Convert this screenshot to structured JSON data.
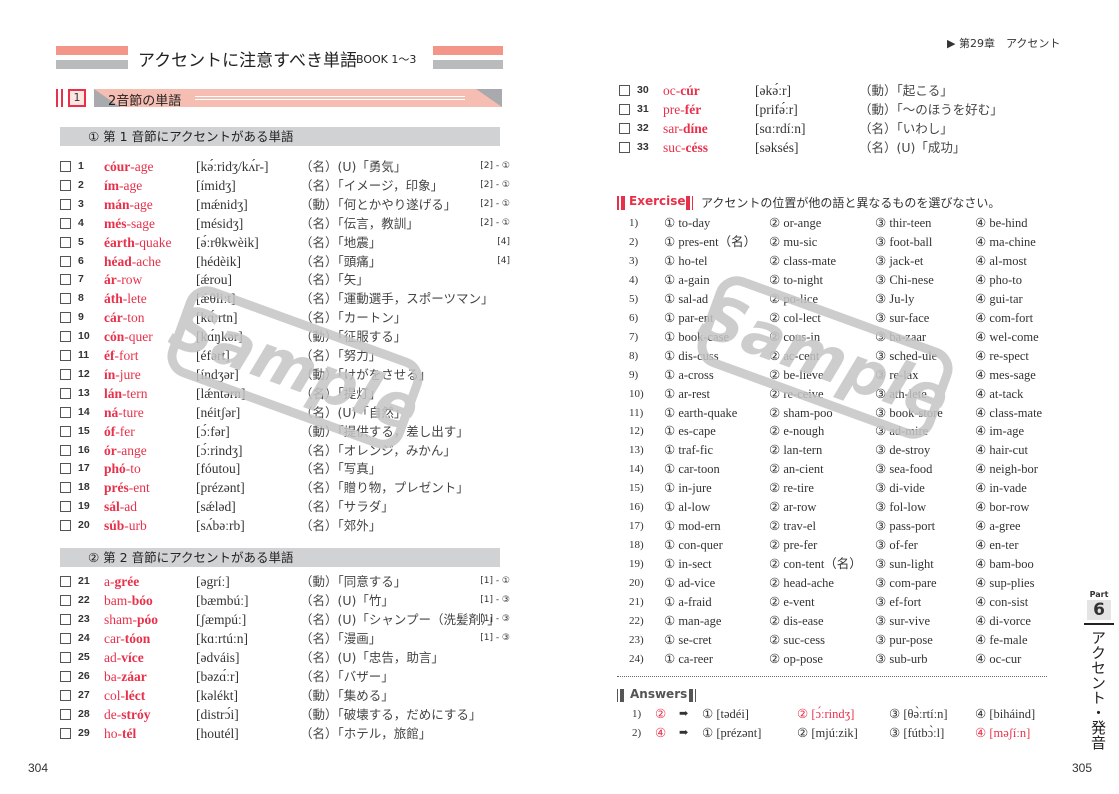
{
  "left_page": {
    "title": "アクセントに注意すべき単語",
    "title_sub": "BOOK 1〜3",
    "section_num": "1",
    "section_title": "2音節の単語",
    "sub1": "① 第 1 音節にアクセントがある単語",
    "sub2": "② 第 2 音節にアクセントがある単語",
    "page_number": "304",
    "entries1": [
      {
        "n": "1",
        "w": [
          {
            "t": "cóur",
            "b": true
          },
          {
            "t": "-age",
            "b": false
          }
        ],
        "p": "[kə́ːridʒ/kʌ́r-]",
        "m": "（名）(U)「勇気」",
        "r": "[2] - ①"
      },
      {
        "n": "2",
        "w": [
          {
            "t": "ím",
            "b": true
          },
          {
            "t": "-age",
            "b": false
          }
        ],
        "p": "[ímidʒ]",
        "m": "（名）「イメージ，印象」",
        "r": "[2] - ①"
      },
      {
        "n": "3",
        "w": [
          {
            "t": "mán",
            "b": true
          },
          {
            "t": "-age",
            "b": false
          }
        ],
        "p": "[mǽnidʒ]",
        "m": "（動）「何とかやり遂げる」",
        "r": "[2] - ①"
      },
      {
        "n": "4",
        "w": [
          {
            "t": "més",
            "b": true
          },
          {
            "t": "-sage",
            "b": false
          }
        ],
        "p": "[mésidʒ]",
        "m": "（名）「伝言，教訓」",
        "r": "[2] - ①"
      },
      {
        "n": "5",
        "w": [
          {
            "t": "éarth",
            "b": true
          },
          {
            "t": "-quake",
            "b": false
          }
        ],
        "p": "[ə́ːrθkwèik]",
        "m": "（名）「地震」",
        "r": "[4]"
      },
      {
        "n": "6",
        "w": [
          {
            "t": "héad",
            "b": true
          },
          {
            "t": "-ache",
            "b": false
          }
        ],
        "p": "[hédèik]",
        "m": "（名）「頭痛」",
        "r": "[4]"
      },
      {
        "n": "7",
        "w": [
          {
            "t": "ár",
            "b": true
          },
          {
            "t": "-row",
            "b": false
          }
        ],
        "p": "[ǽrou]",
        "m": "（名）「矢」",
        "r": ""
      },
      {
        "n": "8",
        "w": [
          {
            "t": "áth",
            "b": true
          },
          {
            "t": "-lete",
            "b": false
          }
        ],
        "p": "[ǽθliːt]",
        "m": "（名）「運動選手，スポーツマン」",
        "r": ""
      },
      {
        "n": "9",
        "w": [
          {
            "t": "cár",
            "b": true
          },
          {
            "t": "-ton",
            "b": false
          }
        ],
        "p": "[kɑ́ːrtn]",
        "m": "（名）「カートン」",
        "r": ""
      },
      {
        "n": "10",
        "w": [
          {
            "t": "cón",
            "b": true
          },
          {
            "t": "-quer",
            "b": false
          }
        ],
        "p": "[kɑ́ŋkər]",
        "m": "（動）「征服する」",
        "r": ""
      },
      {
        "n": "11",
        "w": [
          {
            "t": "éf",
            "b": true
          },
          {
            "t": "-fort",
            "b": false
          }
        ],
        "p": "[éfərt]",
        "m": "（名）「努力」",
        "r": ""
      },
      {
        "n": "12",
        "w": [
          {
            "t": "ín",
            "b": true
          },
          {
            "t": "-jure",
            "b": false
          }
        ],
        "p": "[índʒər]",
        "m": "（動）「けがをさせる」",
        "r": ""
      },
      {
        "n": "13",
        "w": [
          {
            "t": "lán",
            "b": true
          },
          {
            "t": "-tern",
            "b": false
          }
        ],
        "p": "[lǽntərn]",
        "m": "（名）「提灯」",
        "r": ""
      },
      {
        "n": "14",
        "w": [
          {
            "t": "ná",
            "b": true
          },
          {
            "t": "-ture",
            "b": false
          }
        ],
        "p": "[néitʃər]",
        "m": "（名）(U)「自然」",
        "r": ""
      },
      {
        "n": "15",
        "w": [
          {
            "t": "óf",
            "b": true
          },
          {
            "t": "-fer",
            "b": false
          }
        ],
        "p": "[ɔ́ːfər]",
        "m": "（動）「提供する，差し出す」",
        "r": ""
      },
      {
        "n": "16",
        "w": [
          {
            "t": "ór",
            "b": true
          },
          {
            "t": "-ange",
            "b": false
          }
        ],
        "p": "[ɔ́ːrindʒ]",
        "m": "（名）「オレンジ，みかん」",
        "r": ""
      },
      {
        "n": "17",
        "w": [
          {
            "t": "phó",
            "b": true
          },
          {
            "t": "-to",
            "b": false
          }
        ],
        "p": "[fóutou]",
        "m": "（名）「写真」",
        "r": ""
      },
      {
        "n": "18",
        "w": [
          {
            "t": "prés",
            "b": true
          },
          {
            "t": "-ent",
            "b": false
          }
        ],
        "p": "[prézənt]",
        "m": "（名）「贈り物，プレゼント」",
        "r": ""
      },
      {
        "n": "19",
        "w": [
          {
            "t": "sál",
            "b": true
          },
          {
            "t": "-ad",
            "b": false
          }
        ],
        "p": "[sǽləd]",
        "m": "（名）「サラダ」",
        "r": ""
      },
      {
        "n": "20",
        "w": [
          {
            "t": "súb",
            "b": true
          },
          {
            "t": "-urb",
            "b": false
          }
        ],
        "p": "[sʌ́bəːrb]",
        "m": "（名）「郊外」",
        "r": ""
      }
    ],
    "entries2": [
      {
        "n": "21",
        "w": [
          {
            "t": "a-",
            "b": false
          },
          {
            "t": "grée",
            "b": true
          }
        ],
        "p": "[əgríː]",
        "m": "（動）「同意する」",
        "r": "[1] - ①"
      },
      {
        "n": "22",
        "w": [
          {
            "t": "bam-",
            "b": false
          },
          {
            "t": "bóo",
            "b": true
          }
        ],
        "p": "[bæmbúː]",
        "m": "（名）(U)「竹」",
        "r": "[1] - ③"
      },
      {
        "n": "23",
        "w": [
          {
            "t": "sham-",
            "b": false
          },
          {
            "t": "póo",
            "b": true
          }
        ],
        "p": "[ʃæmpúː]",
        "m": "（名）(U)「シャンプー（洗髪剤）」",
        "r": "[1] - ③"
      },
      {
        "n": "24",
        "w": [
          {
            "t": "car-",
            "b": false
          },
          {
            "t": "tóon",
            "b": true
          }
        ],
        "p": "[kɑːrtúːn]",
        "m": "（名）「漫画」",
        "r": "[1] - ③"
      },
      {
        "n": "25",
        "w": [
          {
            "t": "ad-",
            "b": false
          },
          {
            "t": "více",
            "b": true
          }
        ],
        "p": "[ədváis]",
        "m": "（名）(U)「忠告，助言」",
        "r": ""
      },
      {
        "n": "26",
        "w": [
          {
            "t": "ba-",
            "b": false
          },
          {
            "t": "záar",
            "b": true
          }
        ],
        "p": "[bəzɑ́ːr]",
        "m": "（名）「バザー」",
        "r": ""
      },
      {
        "n": "27",
        "w": [
          {
            "t": "col-",
            "b": false
          },
          {
            "t": "léct",
            "b": true
          }
        ],
        "p": "[kəlékt]",
        "m": "（動）「集める」",
        "r": ""
      },
      {
        "n": "28",
        "w": [
          {
            "t": "de-",
            "b": false
          },
          {
            "t": "stróy",
            "b": true
          }
        ],
        "p": "[distrɔ́i]",
        "m": "（動）「破壊する，だめにする」",
        "r": ""
      },
      {
        "n": "29",
        "w": [
          {
            "t": "ho-",
            "b": false
          },
          {
            "t": "tél",
            "b": true
          }
        ],
        "p": "[houtél]",
        "m": "（名）「ホテル，旅館」",
        "r": ""
      }
    ]
  },
  "right_page": {
    "running_head": "▶ 第29章　アクセント",
    "page_number": "305",
    "side_tab": {
      "part_label": "Part",
      "part_number": "6",
      "vertical_title": "アクセント・発音"
    },
    "entries": [
      {
        "n": "30",
        "w": [
          {
            "t": "oc-",
            "b": false
          },
          {
            "t": "cúr",
            "b": true
          }
        ],
        "p": "[əkə́ːr]",
        "m": "（動）「起こる」"
      },
      {
        "n": "31",
        "w": [
          {
            "t": "pre-",
            "b": false
          },
          {
            "t": "fér",
            "b": true
          }
        ],
        "p": "[prifə́ːr]",
        "m": "（動）「〜のほうを好む」"
      },
      {
        "n": "32",
        "w": [
          {
            "t": "sar-",
            "b": false
          },
          {
            "t": "díne",
            "b": true
          }
        ],
        "p": "[sɑːrdíːn]",
        "m": "（名）「いわし」"
      },
      {
        "n": "33",
        "w": [
          {
            "t": "suc-",
            "b": false
          },
          {
            "t": "céss",
            "b": true
          }
        ],
        "p": "[səksés]",
        "m": "（名）(U)「成功」"
      }
    ],
    "exercise": {
      "label": "Exercise",
      "instruction": "アクセントの位置が他の語と異なるものを選びなさい。",
      "items": [
        {
          "n": "1)",
          "o": [
            "① to-day",
            "② or-ange",
            "③ thir-teen",
            "④ be-hind"
          ]
        },
        {
          "n": "2)",
          "o": [
            "① pres-ent（名）",
            "② mu-sic",
            "③ foot-ball",
            "④ ma-chine"
          ]
        },
        {
          "n": "3)",
          "o": [
            "① ho-tel",
            "② class-mate",
            "③ jack-et",
            "④ al-most"
          ]
        },
        {
          "n": "4)",
          "o": [
            "① a-gain",
            "② to-night",
            "③ Chi-nese",
            "④ pho-to"
          ]
        },
        {
          "n": "5)",
          "o": [
            "① sal-ad",
            "② po-lice",
            "③ Ju-ly",
            "④ gui-tar"
          ]
        },
        {
          "n": "6)",
          "o": [
            "① par-ent",
            "② col-lect",
            "③ sur-face",
            "④ com-fort"
          ]
        },
        {
          "n": "7)",
          "o": [
            "① book-case",
            "② cous-in",
            "③ ba-zaar",
            "④ wel-come"
          ]
        },
        {
          "n": "8)",
          "o": [
            "① dis-cuss",
            "② ac-cent",
            "③ sched-ule",
            "④ re-spect"
          ]
        },
        {
          "n": "9)",
          "o": [
            "① a-cross",
            "② be-lieve",
            "③ re-lax",
            "④ mes-sage"
          ]
        },
        {
          "n": "10)",
          "o": [
            "① ar-rest",
            "② re-ceive",
            "③ ath-lete",
            "④ at-tack"
          ]
        },
        {
          "n": "11)",
          "o": [
            "① earth-quake",
            "② sham-poo",
            "③ book-store",
            "④ class-mate"
          ]
        },
        {
          "n": "12)",
          "o": [
            "① es-cape",
            "② e-nough",
            "③ ad-mire",
            "④ im-age"
          ]
        },
        {
          "n": "13)",
          "o": [
            "① traf-fic",
            "② lan-tern",
            "③ de-stroy",
            "④ hair-cut"
          ]
        },
        {
          "n": "14)",
          "o": [
            "① car-toon",
            "② an-cient",
            "③ sea-food",
            "④ neigh-bor"
          ]
        },
        {
          "n": "15)",
          "o": [
            "① in-jure",
            "② re-tire",
            "③ di-vide",
            "④ in-vade"
          ]
        },
        {
          "n": "16)",
          "o": [
            "① al-low",
            "② ar-row",
            "③ fol-low",
            "④ bor-row"
          ]
        },
        {
          "n": "17)",
          "o": [
            "① mod-ern",
            "② trav-el",
            "③ pass-port",
            "④ a-gree"
          ]
        },
        {
          "n": "18)",
          "o": [
            "① con-quer",
            "② pre-fer",
            "③ of-fer",
            "④ en-ter"
          ]
        },
        {
          "n": "19)",
          "o": [
            "① in-sect",
            "② con-tent（名）",
            "③ sun-light",
            "④ bam-boo"
          ]
        },
        {
          "n": "20)",
          "o": [
            "① ad-vice",
            "② head-ache",
            "③ com-pare",
            "④ sup-plies"
          ]
        },
        {
          "n": "21)",
          "o": [
            "① a-fraid",
            "② e-vent",
            "③ ef-fort",
            "④ con-sist"
          ]
        },
        {
          "n": "22)",
          "o": [
            "① man-age",
            "② dis-ease",
            "③ sur-vive",
            "④ di-vorce"
          ]
        },
        {
          "n": "23)",
          "o": [
            "① se-cret",
            "② suc-cess",
            "③ pur-pose",
            "④ fe-male"
          ]
        },
        {
          "n": "24)",
          "o": [
            "① ca-reer",
            "② op-pose",
            "③ sub-urb",
            "④ oc-cur"
          ]
        }
      ]
    },
    "answers": {
      "label": "Answers",
      "arrow": "➡",
      "items": [
        {
          "n": "1)",
          "a": "②",
          "o": [
            "① [tədéi]",
            "② [ɔ́ːrindʒ]",
            "③ [θə̀ːrtíːn]",
            "④ [biháind]"
          ],
          "hi": 1
        },
        {
          "n": "2)",
          "a": "④",
          "o": [
            "① [prézənt]",
            "② [mjúːzik]",
            "③ [fútbɔ̀ːl]",
            "④ [məʃíːn]"
          ],
          "hi": 3
        }
      ]
    },
    "watermark": "Sample"
  },
  "colors": {
    "accent_red": "#e8304a",
    "salmon": "#f4958a",
    "gray_bar": "#c8c9cb"
  }
}
